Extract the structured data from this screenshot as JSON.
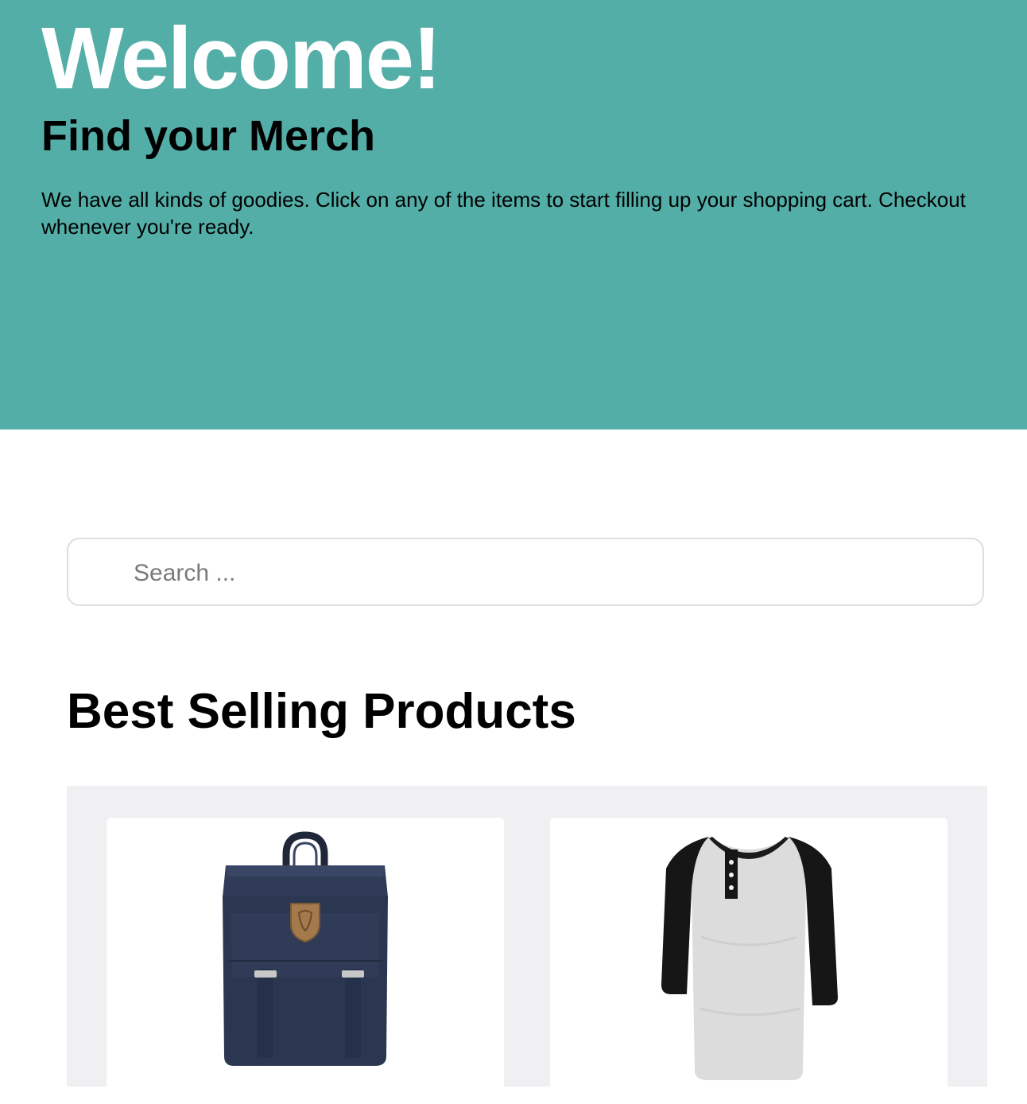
{
  "hero": {
    "title": "Welcome!",
    "subtitle": "Find your Merch",
    "description": "We have all kinds of goodies. Click on any of the items to start filling up your shopping cart. Checkout whenever you're ready."
  },
  "search": {
    "placeholder": "Search ..."
  },
  "products_section": {
    "title": "Best Selling Products",
    "items": [
      {
        "image": "navy-backpack"
      },
      {
        "image": "raglan-henley-shirt"
      }
    ]
  },
  "colors": {
    "hero_background": "#54aea8",
    "panel_background": "#f0f0f2",
    "backpack": "#2b3650",
    "shirt_body": "#dcdcdc",
    "shirt_sleeves": "#161616"
  }
}
